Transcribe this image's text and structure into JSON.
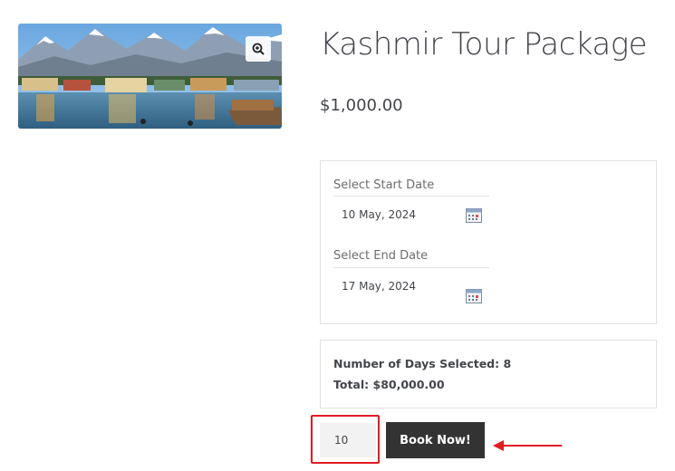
{
  "product": {
    "title": "Kashmir Tour Package",
    "price": "$1,000.00",
    "image_alt": "Dal Lake with snow-capped mountains",
    "zoom_icon": "zoom-in-icon"
  },
  "booking": {
    "start_label": "Select Start Date",
    "start_value": "10 May, 2024",
    "end_label": "Select End Date",
    "end_value": "17 May, 2024",
    "calendar_icon": "calendar-icon"
  },
  "summary": {
    "days_line": "Number of Days Selected: 8",
    "total_line": "Total: $80,000.00"
  },
  "cart": {
    "quantity": "10",
    "button_label": "Book Now!"
  },
  "colors": {
    "highlight": "#e31b23",
    "button_bg": "#333333",
    "text": "#43454b"
  }
}
